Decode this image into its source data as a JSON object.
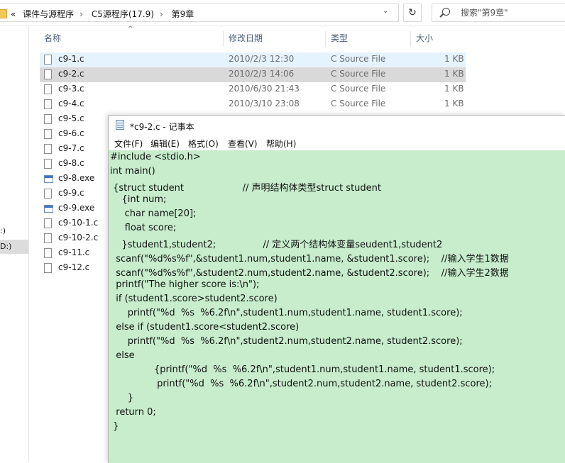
{
  "explorer": {
    "breadcrumb": {
      "overflow": "«",
      "items": [
        "课件与源程序",
        "C5源程序(17.9)",
        "第9章"
      ],
      "separator": "›"
    },
    "dropdown_glyph": "⌄",
    "refresh_glyph": "↻",
    "search": {
      "placeholder": "搜索\"第9章\""
    },
    "nav": {
      "drive_a": ":)",
      "drive_b": "D:)"
    },
    "columns": {
      "name": "名称",
      "date": "修改日期",
      "type": "类型",
      "size": "大小"
    },
    "sort_glyph": "^",
    "files_detail": [
      {
        "name": "c9-1.c",
        "date": "2010/2/3 12:30",
        "type": "C Source File",
        "size": "1 KB"
      },
      {
        "name": "c9-2.c",
        "date": "2010/2/3 14:06",
        "type": "C Source File",
        "size": "1 KB"
      },
      {
        "name": "c9-3.c",
        "date": "2010/6/30 21:43",
        "type": "C Source File",
        "size": "1 KB"
      },
      {
        "name": "c9-4.c",
        "date": "2010/3/10 23:08",
        "type": "C Source File",
        "size": "1 KB"
      }
    ],
    "files_names": [
      "c9-5.c",
      "c9-6.c",
      "c9-7.c",
      "c9-8.c",
      "c9-8.exe",
      "c9-9.c",
      "c9-9.exe",
      "c9-10-1.c",
      "c9-10-2.c",
      "c9-11.c",
      "c9-12.c"
    ]
  },
  "notepad": {
    "title": "*c9-2.c - 记事本",
    "menu": [
      "文件(F)",
      "编辑(E)",
      "格式(O)",
      "查看(V)",
      "帮助(H)"
    ],
    "code": [
      "#include <stdio.h>",
      "int main()",
      " {struct student                    // 声明结构体类型struct student",
      "    {int num;",
      "     char name[20];",
      "     float score;",
      "    }student1,student2;                // 定义两个结构体变量seudent1,student2",
      "  scanf(\"%d%s%f\",&student1.num,student1.name, &student1.score);    //输入学生1数据",
      "  scanf(\"%d%s%f\",&student2.num,student2.name, &student2.score);    //输入学生2数据",
      "  printf(\"The higher score is:\\n\");",
      "  if (student1.score>student2.score)",
      "      printf(\"%d  %s  %6.2f\\n\",student1.num,student1.name, student1.score);",
      "  else if (student1.score<student2.score)",
      "      printf(\"%d  %s  %6.2f\\n\",student2.num,student2.name, student2.score);",
      "  else",
      "               {printf(\"%d  %s  %6.2f\\n\",student1.num,student1.name, student1.score);",
      "                printf(\"%d  %s  %6.2f\\n\",student2.num,student2.name, student2.score);",
      "      }",
      "  return 0;",
      " }"
    ]
  },
  "colors": {
    "editor_bg": "#c7edcc",
    "selected_row": "#d9d9d9",
    "hover_row": "#e5f3ff",
    "header_text": "#4c607a"
  }
}
